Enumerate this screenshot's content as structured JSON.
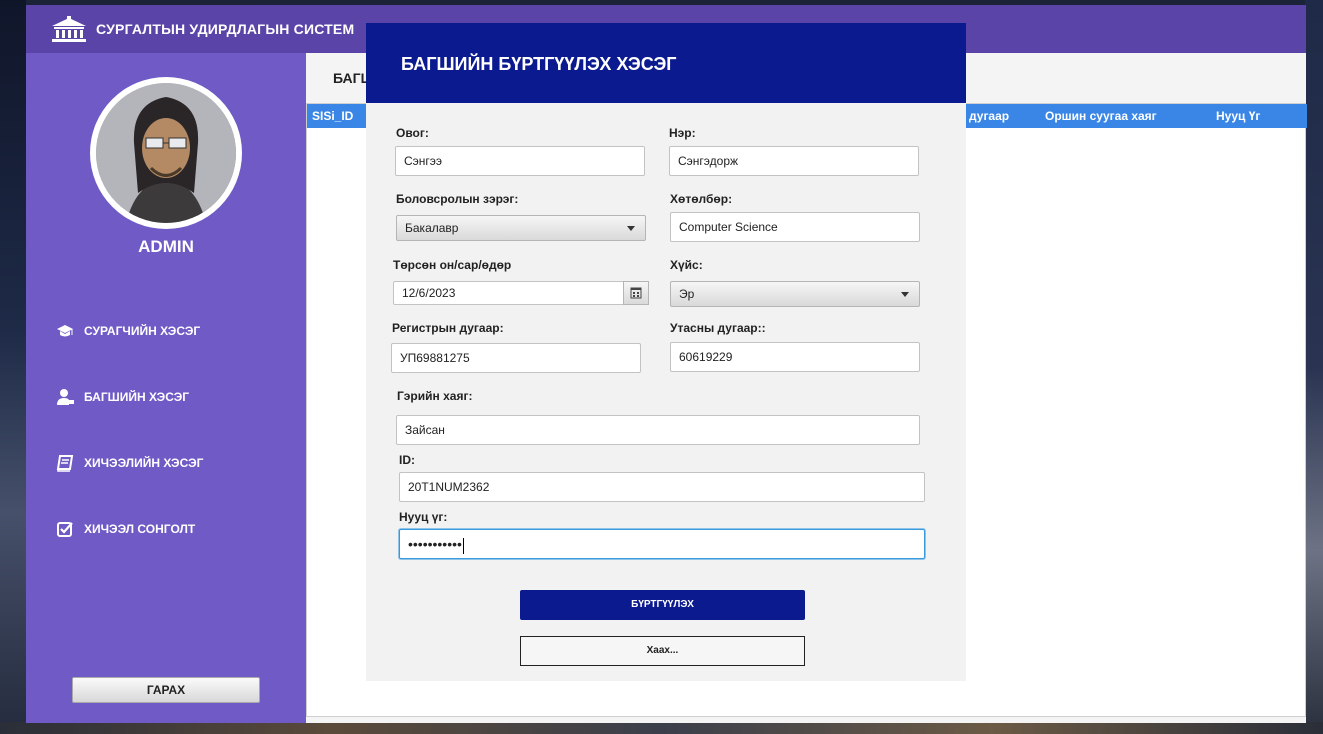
{
  "app": {
    "title": "СУРГАЛТЫН УДИРДЛАГЫН СИСТЕМ"
  },
  "sidebar": {
    "user_label": "ADMIN",
    "items": [
      {
        "label": "СУРАГЧИЙН ХЭСЭГ",
        "icon": "graduation-cap-icon"
      },
      {
        "label": "БАГШИЙН ХЭСЭГ",
        "icon": "teacher-icon"
      },
      {
        "label": "ХИЧЭЭЛИЙН ХЭСЭГ",
        "icon": "book-icon"
      },
      {
        "label": "ХИЧЭЭЛ СОНГОЛТ",
        "icon": "checkbox-icon"
      }
    ],
    "logout_label": "ГАРАХ"
  },
  "main": {
    "title": "БАГШ",
    "table": {
      "columns": [
        "SISi_ID",
        "дугаар",
        "Оршин суугаа хаяг",
        "Нууц Үг"
      ]
    }
  },
  "modal": {
    "title": "БАГШИЙН БҮРТГҮҮЛЭХ ХЭСЭГ",
    "fields": {
      "last_name": {
        "label": "Овог:",
        "value": "Сэнгээ"
      },
      "first_name": {
        "label": "Нэр:",
        "value": "Сэнгэдорж"
      },
      "degree": {
        "label": "Боловсролын зэрэг:",
        "value": "Бакалавр"
      },
      "program": {
        "label": "Хөтөлбөр:",
        "value": "Computer Science"
      },
      "birthdate": {
        "label": "Төрсөн он/сар/өдөр",
        "value": "12/6/2023"
      },
      "gender": {
        "label": "Хүйс:",
        "value": "Эр"
      },
      "register": {
        "label": "Регистрын дугаар:",
        "value": "УП69881275"
      },
      "phone": {
        "label": "Утасны дугаар::",
        "value": "60619229"
      },
      "address": {
        "label": "Гэрийн хаяг:",
        "value": "Зайсан"
      },
      "id": {
        "label": "ID:",
        "value": "20T1NUM2362"
      },
      "password": {
        "label": "Нууц үг:",
        "value": "•••••••••••"
      }
    },
    "register_label": "БҮРТГҮҮЛЭХ",
    "close_label": "Хаах..."
  }
}
